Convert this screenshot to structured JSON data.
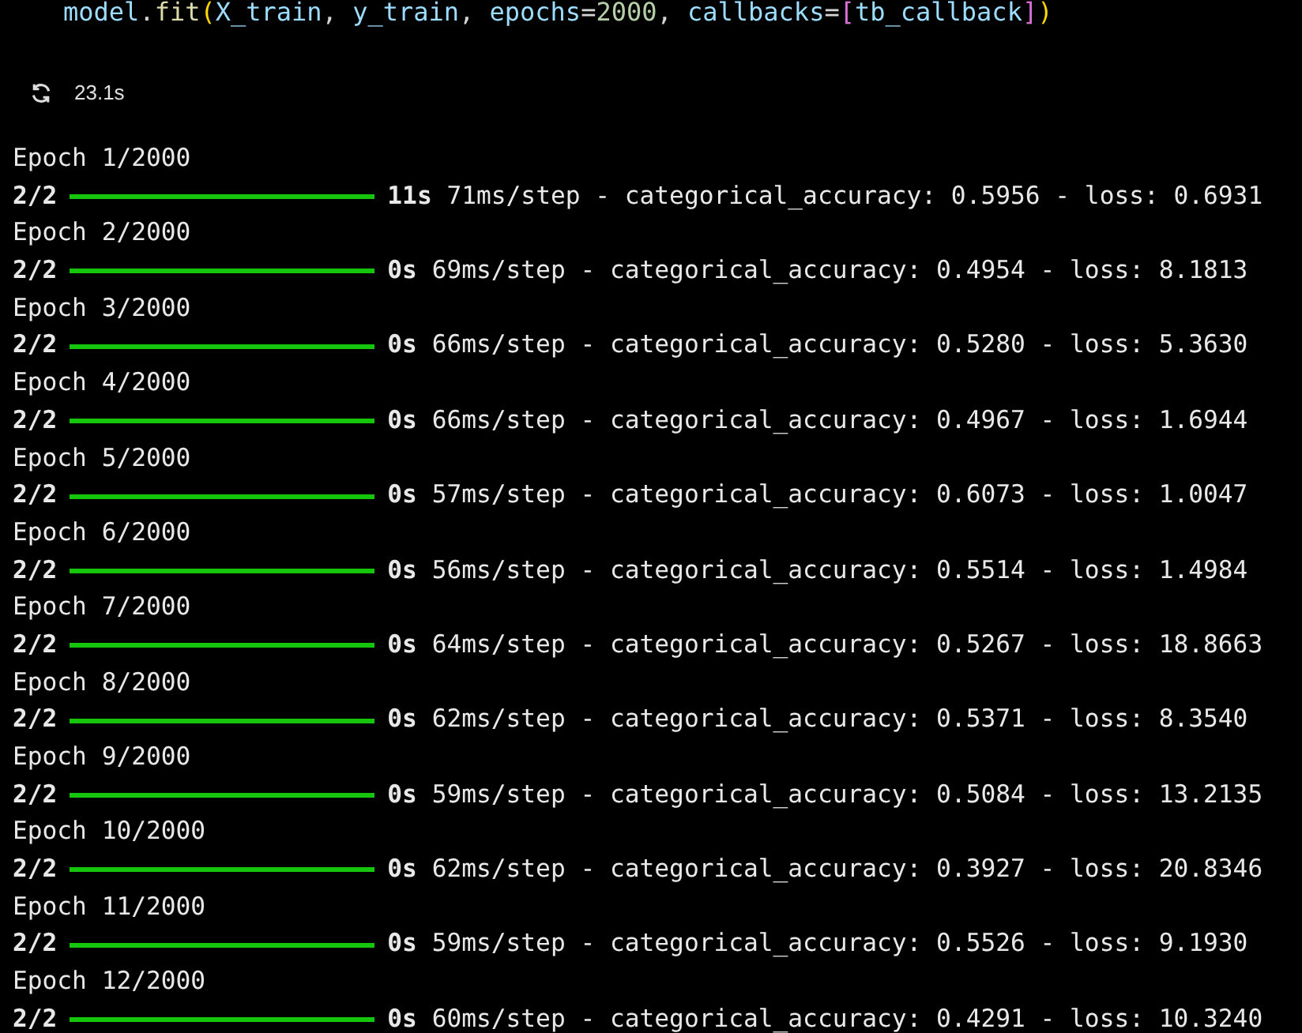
{
  "cell": {
    "code": [
      {
        "text": "model",
        "kind": "var"
      },
      {
        "text": ".",
        "kind": "plain"
      },
      {
        "text": "fit",
        "kind": "func"
      },
      {
        "text": "(",
        "kind": "bracket1"
      },
      {
        "text": "X_train",
        "kind": "var"
      },
      {
        "text": ", ",
        "kind": "plain"
      },
      {
        "text": "y_train",
        "kind": "var"
      },
      {
        "text": ", ",
        "kind": "plain"
      },
      {
        "text": "epochs",
        "kind": "var"
      },
      {
        "text": "=",
        "kind": "plain"
      },
      {
        "text": "2000",
        "kind": "number"
      },
      {
        "text": ", ",
        "kind": "plain"
      },
      {
        "text": "callbacks",
        "kind": "var"
      },
      {
        "text": "=",
        "kind": "plain"
      },
      {
        "text": "[",
        "kind": "bracket2"
      },
      {
        "text": "tb_callback",
        "kind": "var"
      },
      {
        "text": "]",
        "kind": "bracket2"
      },
      {
        "text": ")",
        "kind": "bracket1"
      }
    ],
    "duration": "23.1s"
  },
  "output": [
    {
      "epoch": "Epoch 1/2000",
      "steps": "2/2",
      "level": 1,
      "time": "11s",
      "detail": "71ms/step - categorical_accuracy: 0.5956 - loss: 0.6931"
    },
    {
      "epoch": "Epoch 2/2000",
      "steps": "2/2",
      "level": 1,
      "time": "0s",
      "detail": "69ms/step - categorical_accuracy: 0.4954 - loss: 8.1813"
    },
    {
      "epoch": "Epoch 3/2000",
      "steps": "2/2",
      "level": 1,
      "time": "0s",
      "detail": "66ms/step - categorical_accuracy: 0.5280 - loss: 5.3630"
    },
    {
      "epoch": "Epoch 4/2000",
      "steps": "2/2",
      "level": 1,
      "time": "0s",
      "detail": "66ms/step - categorical_accuracy: 0.4967 - loss: 1.6944"
    },
    {
      "epoch": "Epoch 5/2000",
      "steps": "2/2",
      "level": 1,
      "time": "0s",
      "detail": "57ms/step - categorical_accuracy: 0.6073 - loss: 1.0047"
    },
    {
      "epoch": "Epoch 6/2000",
      "steps": "2/2",
      "level": 1,
      "time": "0s",
      "detail": "56ms/step - categorical_accuracy: 0.5514 - loss: 1.4984"
    },
    {
      "epoch": "Epoch 7/2000",
      "steps": "2/2",
      "level": 1,
      "time": "0s",
      "detail": "64ms/step - categorical_accuracy: 0.5267 - loss: 18.8663"
    },
    {
      "epoch": "Epoch 8/2000",
      "steps": "2/2",
      "level": 1,
      "time": "0s",
      "detail": "62ms/step - categorical_accuracy: 0.5371 - loss: 8.3540"
    },
    {
      "epoch": "Epoch 9/2000",
      "steps": "2/2",
      "level": 1,
      "time": "0s",
      "detail": "59ms/step - categorical_accuracy: 0.5084 - loss: 13.2135"
    },
    {
      "epoch": "Epoch 10/2000",
      "steps": "2/2",
      "level": 1,
      "time": "0s",
      "detail": "62ms/step - categorical_accuracy: 0.3927 - loss: 20.8346"
    },
    {
      "epoch": "Epoch 11/2000",
      "steps": "2/2",
      "level": 1,
      "time": "0s",
      "detail": "59ms/step - categorical_accuracy: 0.5526 - loss: 9.1930"
    },
    {
      "epoch": "Epoch 12/2000",
      "steps": "2/2",
      "level": 1,
      "time": "0s",
      "detail": "60ms/step - categorical_accuracy: 0.4291 - loss: 10.3240"
    }
  ]
}
